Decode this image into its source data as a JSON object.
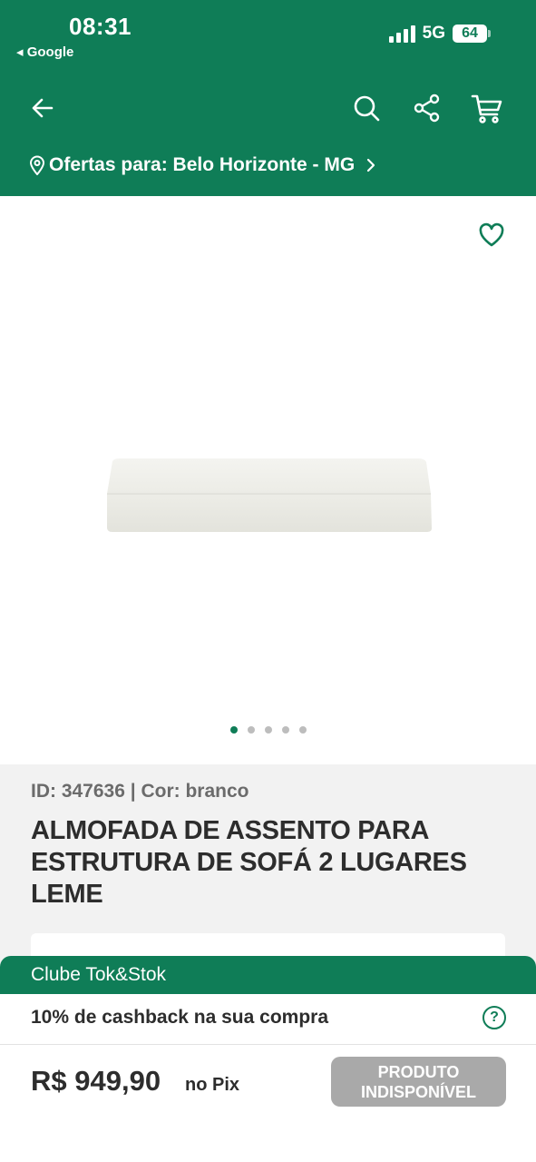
{
  "status_bar": {
    "time": "08:31",
    "back_app": "◂ Google",
    "network": "5G",
    "battery": "64"
  },
  "header": {
    "icons": [
      "arrow-left-icon",
      "search-icon",
      "share-icon",
      "cart-icon"
    ],
    "location_text": "Ofertas para: Belo Horizonte - MG"
  },
  "gallery": {
    "image_count": 5,
    "active_index": 0,
    "favorite_icon": "heart-outline-icon"
  },
  "product": {
    "id_line": "ID: 347636 | Cor: branco",
    "title": "ALMOFADA DE ASSENTO PARA ESTRUTURA DE SOFÁ 2 LUGARES LEME"
  },
  "club": {
    "label": "Clube Tok&Stok",
    "cashback": "10% de cashback na sua compra",
    "help": "?"
  },
  "purchase": {
    "price": "R$ 949,90",
    "price_suffix": "no Pix",
    "button_line1": "PRODUTO",
    "button_line2": "INDISPONÍVEL"
  },
  "colors": {
    "brand": "#0f7d57",
    "disabled_button": "#a9a9a9",
    "info_background": "#f2f2f2"
  }
}
